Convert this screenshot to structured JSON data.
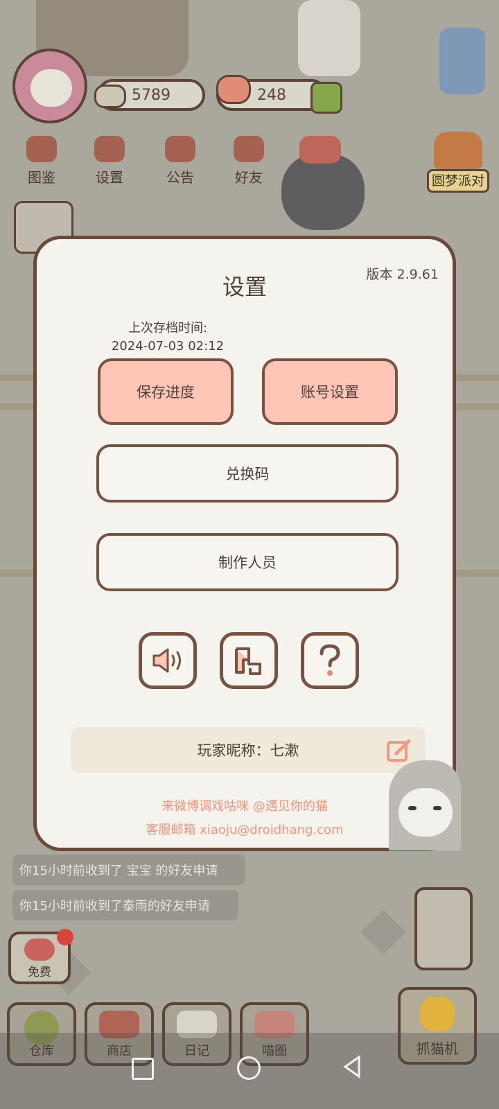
{
  "hud": {
    "coins": "5789",
    "hearts": "248",
    "nav": [
      {
        "label": "图鉴",
        "icon": "cat-album-icon"
      },
      {
        "label": "设置",
        "icon": "gear-icon"
      },
      {
        "label": "公告",
        "icon": "gift-icon"
      },
      {
        "label": "好友",
        "icon": "friends-icon"
      }
    ],
    "event_label": "圆梦派对"
  },
  "dialog": {
    "title": "设置",
    "version": "版本 2.9.61",
    "last_save_label": "上次存档时间:",
    "last_save_time": "2024-07-03 02:12",
    "save_button": "保存进度",
    "account_button": "账号设置",
    "redeem_button": "兑换码",
    "credits_button": "制作人员",
    "icon_buttons": [
      "sound-icon",
      "gamepad-icon",
      "help-icon"
    ],
    "nickname_label": "玩家昵称：七漱",
    "weibo_text": "来微博调戏咕咪 @遇见你的猫",
    "email_text": "客服邮箱 xiaoju@droidhang.com"
  },
  "notices": [
    "你15小时前收到了  宝宝  的好友申请",
    "你15小时前收到了泰雨的好友申请"
  ],
  "free_label": "免费",
  "bottom_nav": [
    "仓库",
    "商店",
    "日记",
    "喵圈"
  ],
  "claw_machine_label": "抓猫机",
  "colors": {
    "accent_pink": "#ffc6b8",
    "border_brown": "#7a5241",
    "footer_orange": "#f0957c"
  }
}
